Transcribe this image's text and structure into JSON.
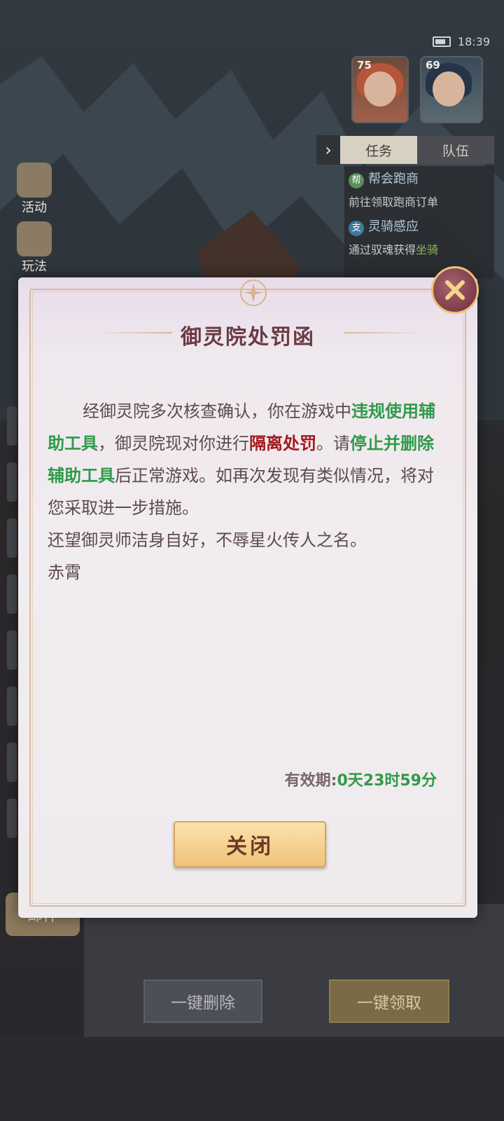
{
  "status_bar": {
    "time": "18:39"
  },
  "team": [
    {
      "level": "75"
    },
    {
      "level": "69"
    }
  ],
  "tabs": {
    "arrow": "›",
    "task": "任务",
    "team": "队伍"
  },
  "tasks": [
    {
      "tag": "帮",
      "name": "帮会跑商",
      "desc": "前往领取跑商订单",
      "tag_color": "#5a8f5a"
    },
    {
      "tag": "支",
      "name": "灵骑感应",
      "desc_prefix": "通过驭魂获得",
      "desc_highlight": "坐骑",
      "tag_color": "#3f7aa0"
    }
  ],
  "side_menu": [
    {
      "label": "活动",
      "icon": "gift-icon"
    },
    {
      "label": "玩法",
      "icon": "scroll-icon"
    }
  ],
  "mail": {
    "tab_label": "邮件",
    "delete_all": "一键删除",
    "claim_all": "一键领取"
  },
  "dialog": {
    "title": "御灵院处罚函",
    "p1_a": "经御灵院多次核查确认，你在游戏中",
    "p1_b": "违规使用辅助工具",
    "p1_c": "，御灵院现对你进行",
    "p1_d": "隔离处罚",
    "p1_e": "。请",
    "p1_f": "停止并删除辅助工具",
    "p1_g": "后正常游戏。如再次发现有类似情况，将对您采取进一步措施。",
    "p2": "还望御灵师洁身自好，不辱星火传人之名。",
    "p3": "赤霄",
    "validity_label": "有效期:",
    "validity_value": "0天23时59分",
    "close_label": "关闭",
    "close_icon": "close-icon"
  },
  "colors": {
    "highlight_green": "#2f9a4a",
    "highlight_red": "#a3191d",
    "title": "#6a3b45",
    "button": "#f0c37a"
  }
}
